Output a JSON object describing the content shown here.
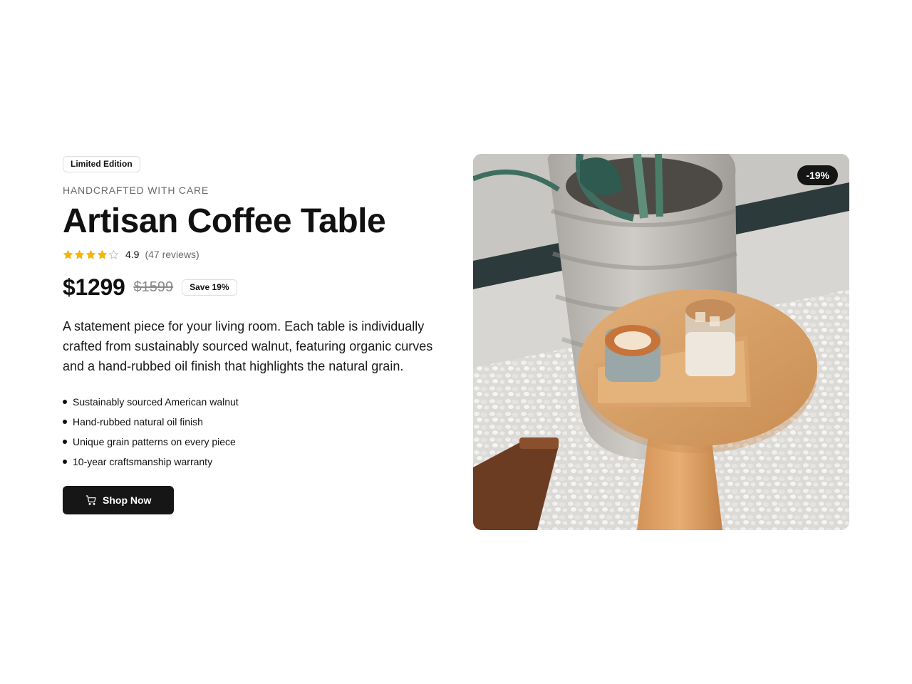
{
  "product": {
    "edition_badge": "Limited Edition",
    "eyebrow": "HANDCRAFTED WITH CARE",
    "title": "Artisan Coffee Table",
    "rating": {
      "value": "4.9",
      "stars_filled": 4,
      "stars_total": 5,
      "count_text": "(47 reviews)",
      "star_color": "#f5b800"
    },
    "price": {
      "current": "$1299",
      "original": "$1599",
      "save_badge": "Save 19%"
    },
    "description": "A statement piece for your living room. Each table is individually crafted from sustainably sourced walnut, featuring organic curves and a hand-rubbed oil finish that highlights the natural grain.",
    "features": [
      "Sustainably sourced American walnut",
      "Hand-rubbed natural oil finish",
      "Unique grain patterns on every piece",
      "10-year craftsmanship warranty"
    ],
    "cta": {
      "label": "Shop Now",
      "icon": "cart-icon"
    }
  },
  "image": {
    "discount_badge": "-19%"
  },
  "colors": {
    "text": "#111111",
    "muted": "#6b6b6b",
    "button_bg": "#161616",
    "star": "#f5b800"
  }
}
